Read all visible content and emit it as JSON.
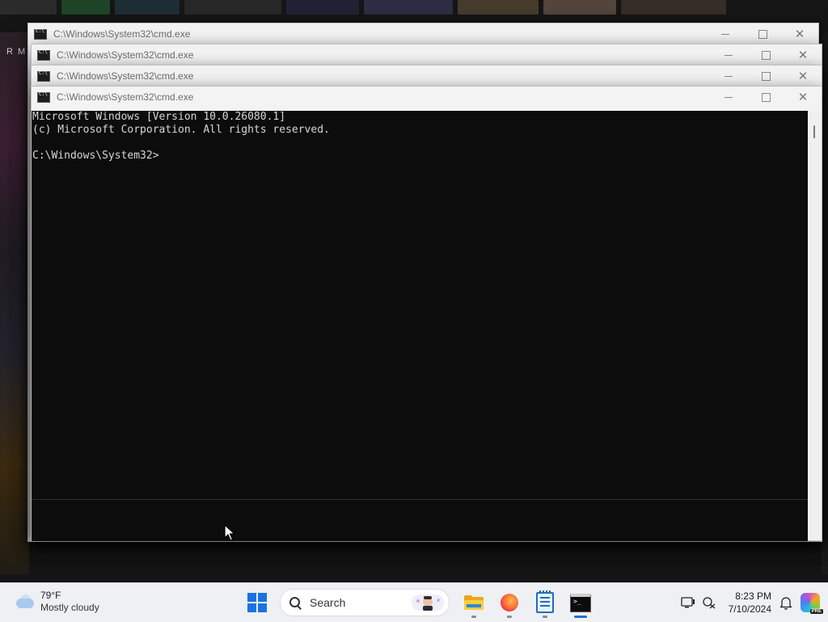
{
  "windows": [
    {
      "title": "C:\\Windows\\System32\\cmd.exe"
    },
    {
      "title": "C:\\Windows\\System32\\cmd.exe"
    },
    {
      "title": "C:\\Windows\\System32\\cmd.exe"
    },
    {
      "title": "C:\\Windows\\System32\\cmd.exe"
    }
  ],
  "console": {
    "line1": "Microsoft Windows [Version 10.0.26080.1]",
    "line2": "(c) Microsoft Corporation. All rights reserved.",
    "line3": "",
    "prompt": "C:\\Windows\\System32>"
  },
  "background_text": {
    "a": "R",
    "b": "M"
  },
  "taskbar": {
    "weather": {
      "temp": "79°F",
      "condition": "Mostly cloudy",
      "icon": "cloud-icon"
    },
    "search_label": "Search",
    "pinned": [
      {
        "name": "start",
        "icon": "windows-start-icon"
      },
      {
        "name": "file-explorer",
        "icon": "folder-icon"
      },
      {
        "name": "firefox",
        "icon": "firefox-icon"
      },
      {
        "name": "notepad",
        "icon": "notepad-icon"
      },
      {
        "name": "command-prompt",
        "icon": "cmd-icon",
        "active": true
      }
    ],
    "clock": {
      "time": "8:23 PM",
      "date": "7/10/2024"
    },
    "copilot_badge": "PRE"
  },
  "colors": {
    "console_bg": "#0c0c0c",
    "console_fg": "#d6d6d6",
    "titlebar_bg": "#f3f3f3",
    "taskbar_bg": "#eef0f3",
    "accent": "#1a73e0"
  }
}
